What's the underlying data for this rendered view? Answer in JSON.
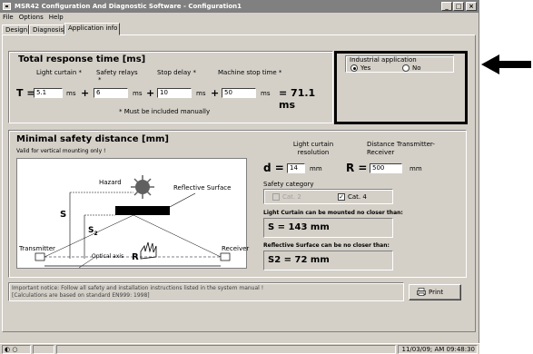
{
  "window": {
    "title": "MSR42 Configuration And Diagnostic Software - Configuration1",
    "buttons": {
      "minimize": "_",
      "maximize": "□",
      "close": "×"
    }
  },
  "menu": [
    "File",
    "Options",
    "Help"
  ],
  "tabs": [
    "Design",
    "Diagnosis",
    "Application info"
  ],
  "response": {
    "title": "Total response time [ms]",
    "col_light_curtain": "Light curtain *",
    "col_safety_relays": "Safety relays",
    "col_stop_delay": "Stop delay *",
    "col_machine_stop": "Machine stop time *",
    "t_label": "T =",
    "light_curtain_value": "5.1",
    "safety_relays_value": "6",
    "stop_delay_value": "10",
    "machine_stop_value": "50",
    "unit": "ms",
    "plus": "+",
    "result": "= 71.1 ms",
    "footnote": "* Must be included manually"
  },
  "industrial": {
    "legend": "Industrial application",
    "yes": "Yes",
    "no": "No",
    "selected": "Yes"
  },
  "safety": {
    "title": "Minimal safety distance [mm]",
    "valid_note": "Valid for vertical mounting only !",
    "diagram": {
      "hazard": "Hazard",
      "reflective": "Reflective Surface",
      "transmitter": "Transmitter",
      "receiver": "Receiver",
      "optical_axis": "Optical axis",
      "s": "S",
      "s2": "S",
      "s2_sub": "2",
      "r": "R"
    },
    "resolution_label": "Light curtain resolution",
    "distance_label": "Distance Transmitter-Receiver",
    "d_label": "d =",
    "d_value": "14",
    "r_label": "R =",
    "r_value": "500",
    "unit": "mm",
    "category_label": "Safety category",
    "cat2": "Cat. 2",
    "cat4": "Cat. 4",
    "cat2_checked": false,
    "cat4_checked": true,
    "curtain_note": "Light Curtain can be mounted no closer than:",
    "curtain_result": "S = 143 mm",
    "reflective_note": "Reflective Surface can be no closer than:",
    "reflective_result": "S2 = 72 mm"
  },
  "notice": {
    "line1": "Important notice: Follow all safety and installation instructions listed in the system manual !",
    "line2": "[Calculations are based on standard EN999: 1998]",
    "print": "Print"
  },
  "statusbar": {
    "datetime": "11/03/09; AM 09:48:30"
  },
  "colors": {
    "face": "#d4d0c8",
    "titlebar": "#808080",
    "highlight_border": "#000000"
  }
}
